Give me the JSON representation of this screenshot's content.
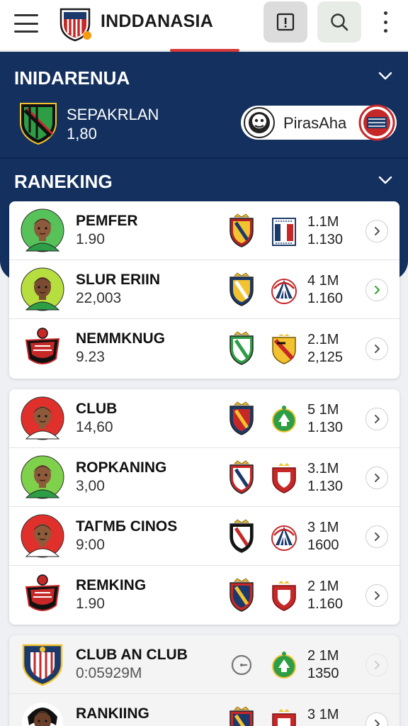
{
  "header": {
    "title": "INDDANASIA",
    "menu_icon": "hamburger-icon",
    "alert_icon": "alert-square-icon",
    "search_icon": "search-icon",
    "more_icon": "kebab-icon"
  },
  "arena": {
    "title": "INIDARENUA",
    "team_a": {
      "name": "SEPAKRLAN",
      "value": "1,80"
    },
    "team_b": {
      "name": "PirasAha"
    }
  },
  "ranking": {
    "title": "RANEKING"
  },
  "cards": [
    {
      "rows": [
        {
          "name": "PEMFER",
          "sub": "1.90",
          "stat1": "1.1M",
          "stat2": "1.130",
          "avatar": "player",
          "skin": "#8d5a3b",
          "shirt": "#2e9e46",
          "bg": "#57c15a",
          "crest1": [
            "#b22222",
            "#f2c230",
            "#1b3a6b"
          ],
          "crest2": "flag",
          "btn_color": "#555"
        },
        {
          "name": "SLUR ERIIN",
          "sub": "22,003",
          "stat1": "4 1M",
          "stat2": "1.160",
          "avatar": "player",
          "skin": "#7a4b30",
          "shirt": "#2e9e46",
          "bg": "#b6de3f",
          "crest1": [
            "#1b3a6b",
            "#f2c230",
            "#ffffff"
          ],
          "crest2": "circle-stripes",
          "btn_color": "#2ea52e"
        },
        {
          "name": "NEMMKNUG",
          "sub": "9.23",
          "stat1": "2.1M",
          "stat2": "2,125",
          "avatar": "crest",
          "skin": "",
          "shirt": "",
          "bg": "#ffffff",
          "crest1": [
            "#2e9e46",
            "#ffffff",
            "#2e9e46"
          ],
          "crest2": "shield-red",
          "btn_color": "#555"
        }
      ]
    },
    {
      "rows": [
        {
          "name": "CLUB",
          "sub": "14,60",
          "stat1": "5 1M",
          "stat2": "1.130",
          "avatar": "player",
          "skin": "#8d5a3b",
          "shirt": "#ffffff",
          "bg": "#e0302b",
          "crest1": [
            "#1b3a6b",
            "#c62828",
            "#f2c230"
          ],
          "crest2": "green-circle",
          "btn_color": "#555"
        },
        {
          "name": "ROPKANING",
          "sub": "3,00",
          "stat1": "3.1M",
          "stat2": "1.130",
          "avatar": "player",
          "skin": "#8d5a3b",
          "shirt": "#2e9e46",
          "bg": "#7fd04a",
          "crest1": [
            "#c62828",
            "#ffffff",
            "#1b3a6b"
          ],
          "crest2": "red-shield",
          "btn_color": "#555"
        },
        {
          "name": "TAГMБ CINOS",
          "sub": "9:00",
          "stat1": "3 1M",
          "stat2": "1600",
          "avatar": "player",
          "skin": "#8d5a3b",
          "shirt": "#ffffff",
          "bg": "#e0302b",
          "crest1": [
            "#111111",
            "#ffffff",
            "#c62828"
          ],
          "crest2": "circle-stripes",
          "btn_color": "#555"
        },
        {
          "name": "REMKING",
          "sub": "1.90",
          "stat1": "2 1M",
          "stat2": "1.160",
          "avatar": "crest",
          "skin": "",
          "shirt": "",
          "bg": "#ffffff",
          "crest1": [
            "#c62828",
            "#1b3a6b",
            "#f2c230"
          ],
          "crest2": "red-shield",
          "btn_color": "#555"
        }
      ]
    },
    {
      "rows": [
        {
          "name": "CLUB AN CLUB",
          "sub": "0:05929M",
          "stat1": "2 1M",
          "stat2": "1350",
          "avatar": "crest-blue",
          "skin": "",
          "shirt": "",
          "bg": "#ffffff",
          "crest1": "timer",
          "crest2": "green-circle",
          "btn_color": "#ccc"
        },
        {
          "name": "RANKIING",
          "sub": "",
          "stat1": "3 1M",
          "stat2": "",
          "avatar": "player-dark",
          "skin": "#6a402a",
          "shirt": "#ffffff",
          "bg": "#ffffff",
          "crest1": [
            "#c62828",
            "#1b3a6b",
            "#f2c230"
          ],
          "crest2": "red-shield",
          "btn_color": "#555"
        }
      ]
    }
  ]
}
